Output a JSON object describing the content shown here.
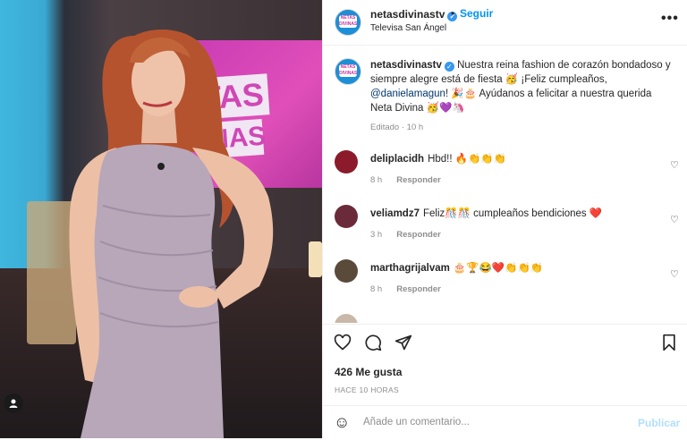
{
  "post": {
    "username": "netasdivinastv",
    "follow_label": "Seguir",
    "location": "Televisa San Ángel",
    "verified_mark": "✓",
    "more_icon": "•••"
  },
  "photo": {
    "screen_text_1": "TAS",
    "screen_text_2": "NAS",
    "user_tag_icon": "person-icon"
  },
  "caption": {
    "username": "netasdivinastv",
    "text_1": "Nuestra reina fashion de corazón bondadoso y siempre alegre está de fiesta 🥳 ¡Feliz cumpleaños, ",
    "mention": "@danielamagun",
    "text_2": "! 🎉🎂 Ayúdanos a felicitar a nuestra querida Neta Divina 🥳💜🦄",
    "meta": "Editado · 10 h"
  },
  "comments": [
    {
      "username": "deliplacidh",
      "text": "Hbd!! 🔥👏👏👏",
      "time": "8 h",
      "reply": "Responder",
      "avatar_color": "#8b1b2a"
    },
    {
      "username": "veliamdz7",
      "text": "Feliz🎊🎊 cumpleaños bendiciones ❤️",
      "time": "3 h",
      "reply": "Responder",
      "avatar_color": "#6b2a3a"
    },
    {
      "username": "marthagrijalvam",
      "text": "🎂🏆😂❤️👏👏👏",
      "time": "8 h",
      "reply": "Responder",
      "avatar_color": "#5a4a3a"
    }
  ],
  "actions": {
    "likes": "426 Me gusta",
    "time_ago": "HACE 10 HORAS",
    "add_comment_placeholder": "Añade un comentario...",
    "publish_label": "Publicar"
  }
}
